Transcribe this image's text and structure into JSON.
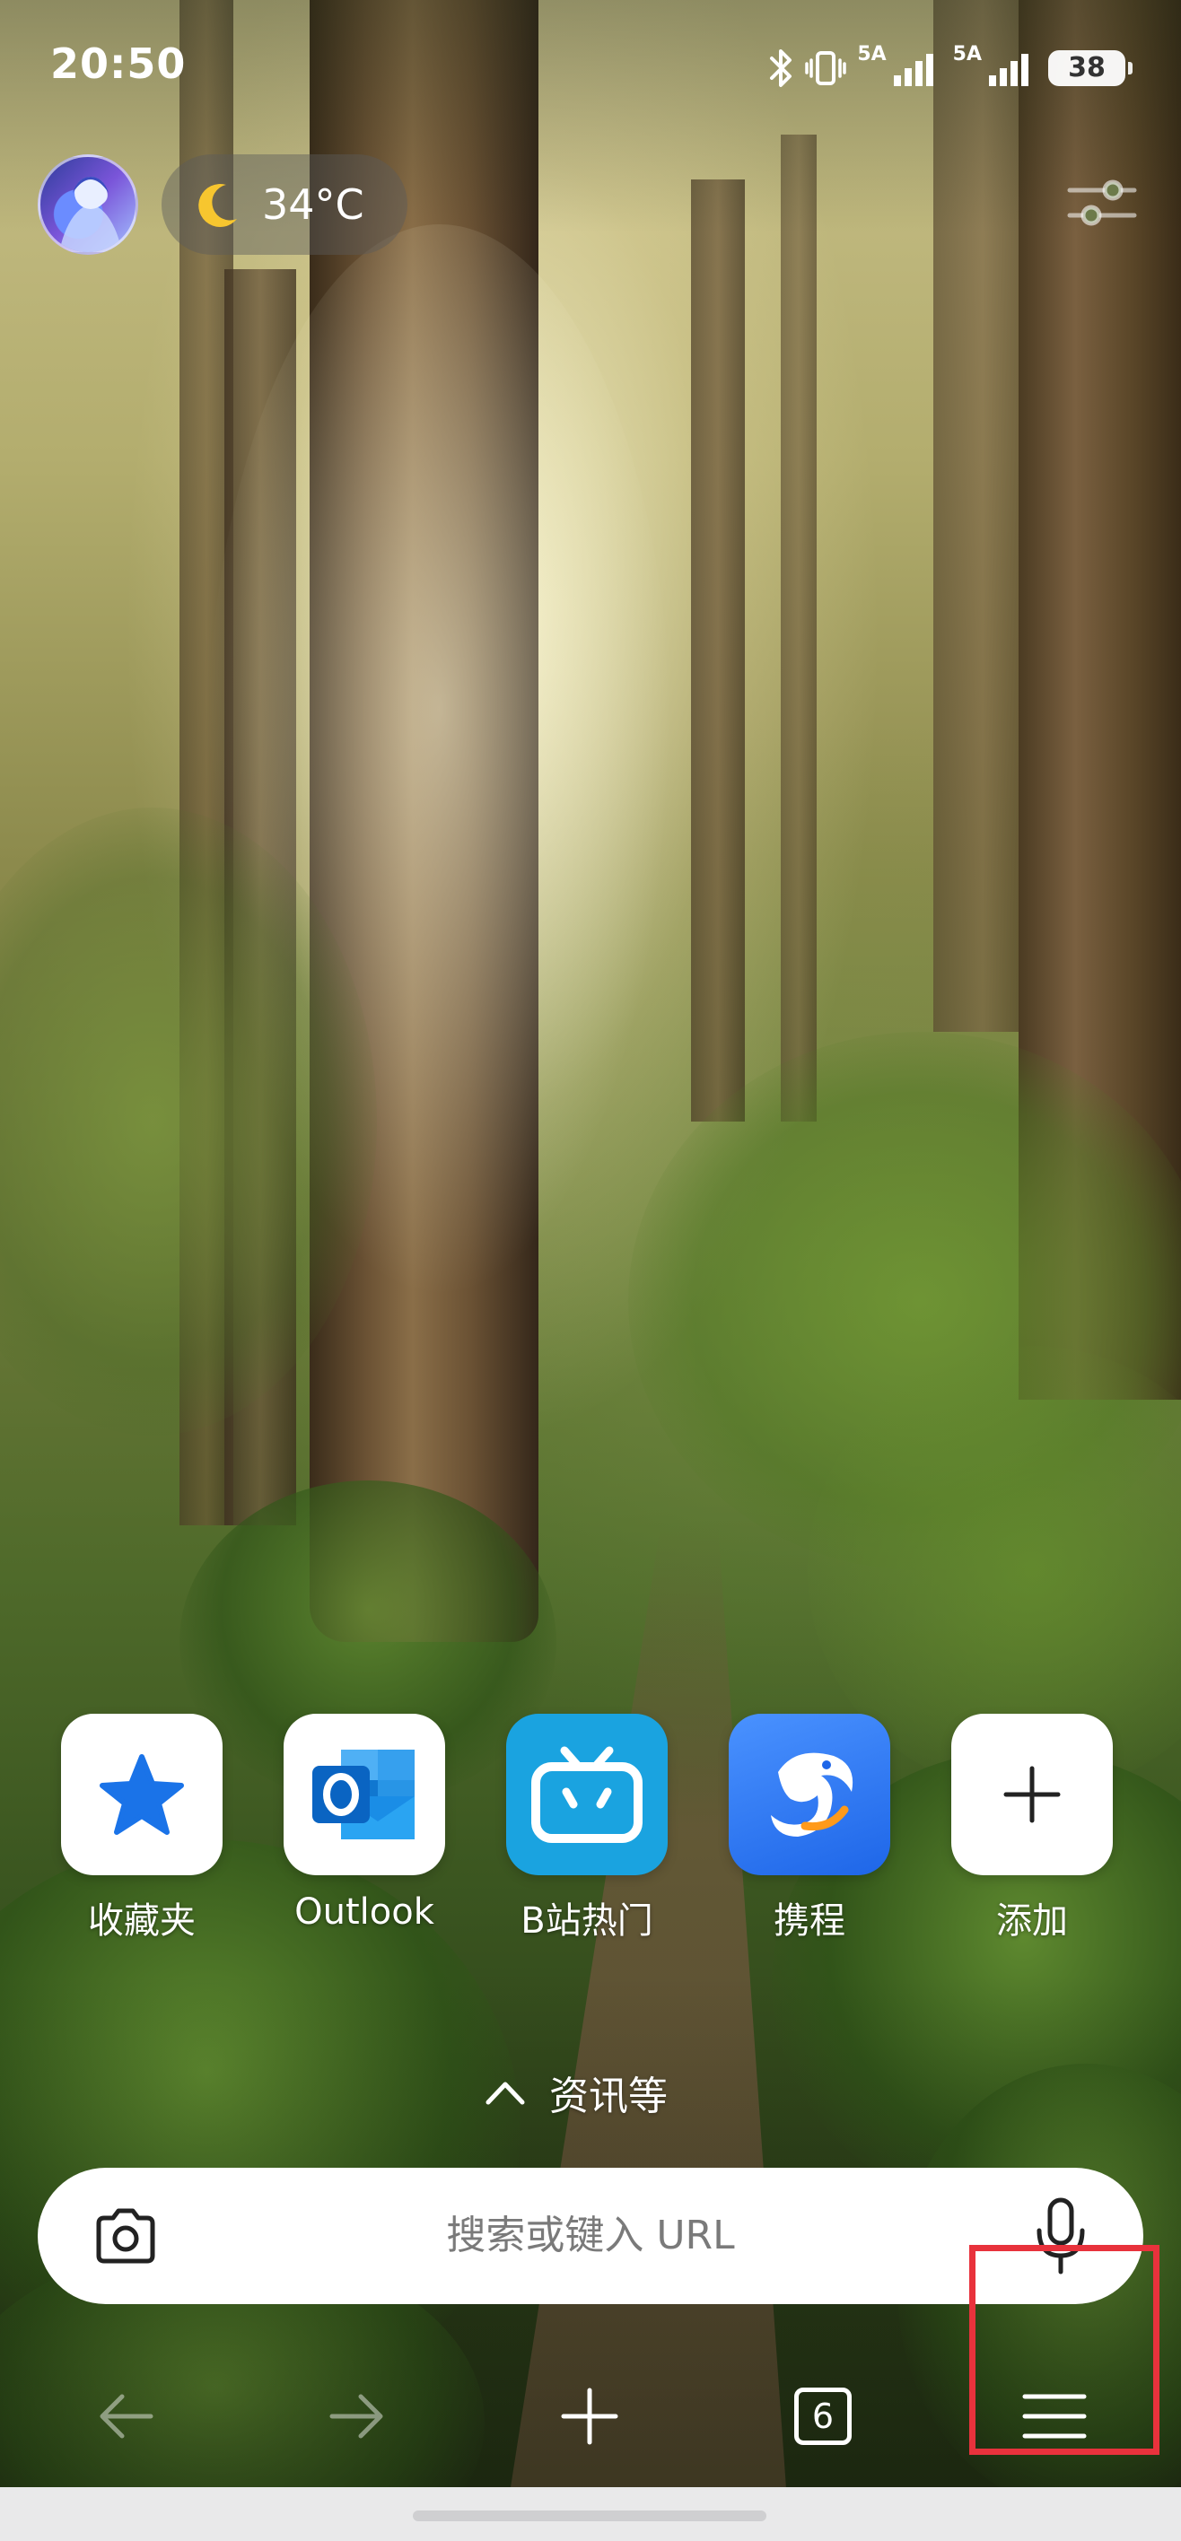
{
  "status_bar": {
    "time": "20:50",
    "signal_1_tag": "5A",
    "signal_2_tag": "5A",
    "battery": "38"
  },
  "weather": {
    "icon": "moon-icon",
    "temperature": "34°C"
  },
  "shortcuts": [
    {
      "label": "收藏夹",
      "icon": "star-icon"
    },
    {
      "label": "Outlook",
      "icon": "outlook-icon"
    },
    {
      "label": "B站热门",
      "icon": "bilibili-icon"
    },
    {
      "label": "携程",
      "icon": "ctrip-icon"
    },
    {
      "label": "添加",
      "icon": "plus-icon"
    }
  ],
  "news_toggle": {
    "label": "资讯等"
  },
  "search": {
    "placeholder": "搜索或键入 URL"
  },
  "bottom_nav": {
    "tab_count": "6"
  },
  "colors": {
    "highlight": "#e8323c",
    "star_blue": "#1a73e8",
    "bilibili_blue": "#1aa3e0",
    "ctrip_blue": "#2b7cf0"
  }
}
